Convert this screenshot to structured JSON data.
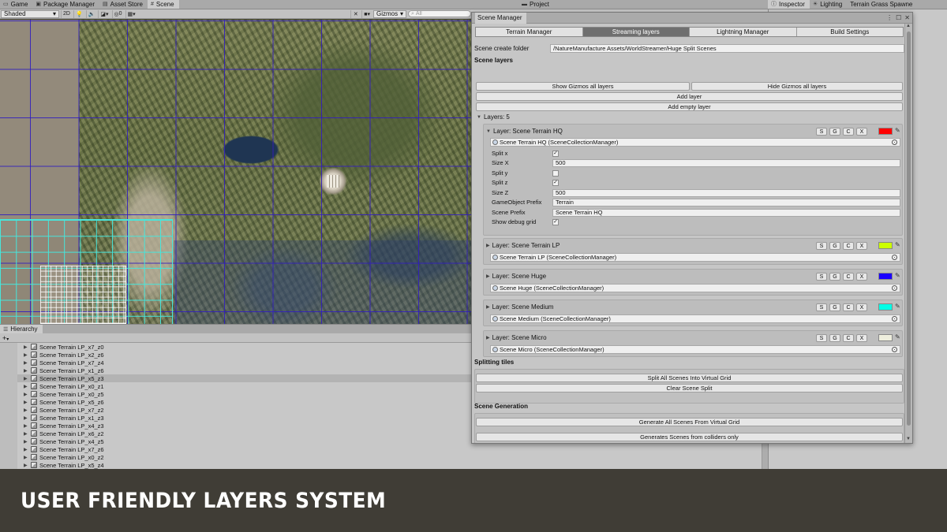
{
  "top_tabs_left": [
    {
      "label": "Game",
      "icon": "game-icon"
    },
    {
      "label": "Package Manager",
      "icon": "package-icon"
    },
    {
      "label": "Asset Store",
      "icon": "store-icon"
    },
    {
      "label": "Scene",
      "icon": "scene-icon",
      "active": true
    }
  ],
  "top_tab_project": {
    "label": "Project",
    "icon": "folder-icon"
  },
  "top_tabs_right": [
    {
      "label": "Inspector",
      "icon": "info-icon",
      "active": true
    },
    {
      "label": "Lighting",
      "icon": "light-icon"
    },
    {
      "label": "Terrain Grass Spawne",
      "icon": ""
    }
  ],
  "scene_toolbar": {
    "shading_mode": "Shaded",
    "mode_2d": "2D",
    "hidden_count": "0",
    "gizmos": "Gizmos",
    "search_placeholder": "All"
  },
  "hierarchy": {
    "title": "Hierarchy",
    "add_label": "+",
    "items": [
      "Scene Terrain LP_x7_z0",
      "Scene Terrain LP_x2_z6",
      "Scene Terrain LP_x7_z4",
      "Scene Terrain LP_x1_z6",
      "Scene Terrain LP_x5_z3",
      "Scene Terrain LP_x0_z1",
      "Scene Terrain LP_x0_z5",
      "Scene Terrain LP_x5_z6",
      "Scene Terrain LP_x7_z2",
      "Scene Terrain LP_x1_z3",
      "Scene Terrain LP_x4_z3",
      "Scene Terrain LP_x6_z2",
      "Scene Terrain LP_x4_z5",
      "Scene Terrain LP_x7_z6",
      "Scene Terrain LP_x0_z2",
      "Scene Terrain LP_x5_z4"
    ],
    "selected_index": 4
  },
  "scene_manager": {
    "title": "Scene Manager",
    "tabs": [
      "Terrain Manager",
      "Streaming layers",
      "Lightning Manager",
      "Build Settings"
    ],
    "active_tab": 1,
    "scene_folder_label": "Scene create folder",
    "scene_folder_value": "/NatureManufacture Assets/WorldStreamer/Huge Split Scenes",
    "scene_layers_heading": "Scene layers",
    "show_gizmos": "Show Gizmos all layers",
    "hide_gizmos": "Hide Gizmos all layers",
    "add_layer": "Add layer",
    "add_empty_layer": "Add empty layer",
    "layers_count_label": "Layers: 5",
    "layer_buttons": [
      "S",
      "G",
      "C",
      "X"
    ],
    "layers": [
      {
        "title": "Layer: Scene Terrain HQ",
        "object": "Scene Terrain HQ (SceneCollectionManager)",
        "color": "#ff0000",
        "expanded": true
      },
      {
        "title": "Layer: Scene Terrain LP",
        "object": "Scene Terrain LP (SceneCollectionManager)",
        "color": "#ccff00",
        "expanded": false
      },
      {
        "title": "Layer: Scene Huge",
        "object": "Scene Huge (SceneCollectionManager)",
        "color": "#1a00ff",
        "expanded": false
      },
      {
        "title": "Layer: Scene Medium",
        "object": "Scene Medium (SceneCollectionManager)",
        "color": "#00ffe6",
        "expanded": false
      },
      {
        "title": "Layer: Scene Micro",
        "object": "Scene Micro (SceneCollectionManager)",
        "color": "#eeeedd",
        "expanded": false
      }
    ],
    "hq_props": {
      "split_x": {
        "label": "Split x",
        "checked": true
      },
      "size_x": {
        "label": "Size X",
        "value": "500"
      },
      "split_y": {
        "label": "Split y",
        "checked": false
      },
      "split_z": {
        "label": "Split z",
        "checked": true
      },
      "size_z": {
        "label": "Size Z",
        "value": "500"
      },
      "go_prefix": {
        "label": "GameObject Prefix",
        "value": "Terrain"
      },
      "scene_prefix": {
        "label": "Scene Prefix",
        "value": "Scene Terrain HQ"
      },
      "debug_grid": {
        "label": "Show debug grid",
        "checked": true
      }
    },
    "splitting_heading": "Splitting tiles",
    "split_all": "Split All Scenes Into Virtual Grid",
    "clear_split": "Clear Scene Split",
    "generation_heading": "Scene Generation",
    "generate_all": "Generate All Scenes From Virtual Grid",
    "generate_colliders": "Generates Scenes from colliders only"
  },
  "caption": "USER FRIENDLY LAYERS SYSTEM"
}
